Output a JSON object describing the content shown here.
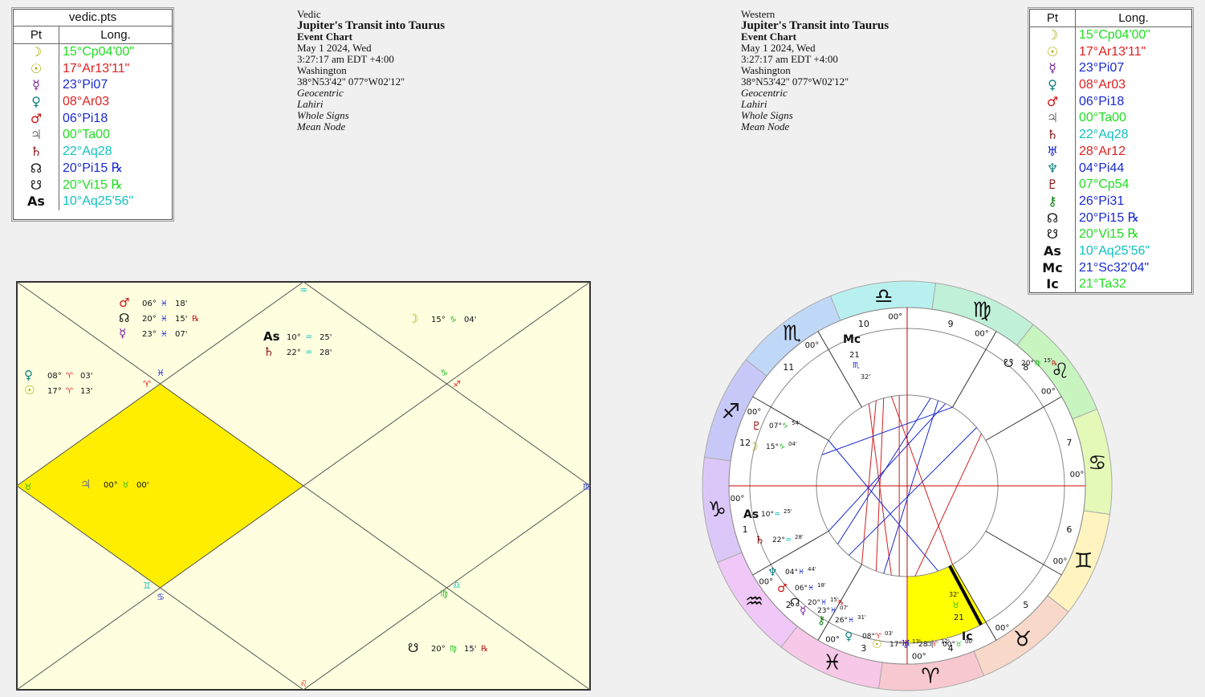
{
  "vedic_table": {
    "caption": "vedic.pts",
    "col_pt": "Pt",
    "col_long": "Long.",
    "rows": [
      {
        "glyph": "☽",
        "value": "15°Cp04'00\"",
        "color": "#22dd22",
        "glyph_color": "#a8a800",
        "icon": "moon-icon"
      },
      {
        "glyph": "☉",
        "value": "17°Ar13'11\"",
        "color": "#e02020",
        "glyph_color": "#a8a800",
        "icon": "sun-icon"
      },
      {
        "glyph": "☿",
        "value": "23°Pi07",
        "color": "#1a2ad0",
        "glyph_color": "#7a1a9a",
        "icon": "mercury-icon"
      },
      {
        "glyph": "♀",
        "value": "08°Ar03",
        "color": "#e02020",
        "glyph_color": "#108080",
        "icon": "venus-icon"
      },
      {
        "glyph": "♂",
        "value": "06°Pi18",
        "color": "#1a2ad0",
        "glyph_color": "#d01010",
        "icon": "mars-icon"
      },
      {
        "glyph": "♃",
        "value": "00°Ta00",
        "color": "#22dd22",
        "glyph_color": "#7a7a7a",
        "icon": "jupiter-icon"
      },
      {
        "glyph": "♄",
        "value": "22°Aq28",
        "color": "#10c0c0",
        "glyph_color": "#8a1010",
        "icon": "saturn-icon"
      },
      {
        "glyph": "☊",
        "value": "20°Pi15 ℞",
        "color": "#1a2ad0",
        "glyph_color": "#111111",
        "icon": "north-node-icon"
      },
      {
        "glyph": "☋",
        "value": "20°Vi15 ℞",
        "color": "#22dd22",
        "glyph_color": "#111111",
        "icon": "south-node-icon"
      },
      {
        "glyph": "As",
        "value": "10°Aq25'56\"",
        "color": "#10c0c0",
        "glyph_color": "#111111",
        "icon": "ascendant-icon"
      }
    ]
  },
  "western_table": {
    "col_pt": "Pt",
    "col_long": "Long.",
    "rows": [
      {
        "glyph": "☽",
        "value": "15°Cp04'00\"",
        "color": "#22dd22",
        "glyph_color": "#a8a800",
        "icon": "moon-icon"
      },
      {
        "glyph": "☉",
        "value": "17°Ar13'11\"",
        "color": "#e02020",
        "glyph_color": "#a8a800",
        "icon": "sun-icon"
      },
      {
        "glyph": "☿",
        "value": "23°Pi07",
        "color": "#1a2ad0",
        "glyph_color": "#7a1a9a",
        "icon": "mercury-icon"
      },
      {
        "glyph": "♀",
        "value": "08°Ar03",
        "color": "#e02020",
        "glyph_color": "#108080",
        "icon": "venus-icon"
      },
      {
        "glyph": "♂",
        "value": "06°Pi18",
        "color": "#1a2ad0",
        "glyph_color": "#d01010",
        "icon": "mars-icon"
      },
      {
        "glyph": "♃",
        "value": "00°Ta00",
        "color": "#22dd22",
        "glyph_color": "#7a7a7a",
        "icon": "jupiter-icon"
      },
      {
        "glyph": "♄",
        "value": "22°Aq28",
        "color": "#10c0c0",
        "glyph_color": "#8a1010",
        "icon": "saturn-icon"
      },
      {
        "glyph": "♅",
        "value": "28°Ar12",
        "color": "#e02020",
        "glyph_color": "#1a2ad0",
        "icon": "uranus-icon"
      },
      {
        "glyph": "♆",
        "value": "04°Pi44",
        "color": "#1a2ad0",
        "glyph_color": "#108080",
        "icon": "neptune-icon"
      },
      {
        "glyph": "♇",
        "value": "07°Cp54",
        "color": "#22dd22",
        "glyph_color": "#8a1010",
        "icon": "pluto-icon"
      },
      {
        "glyph": "⚷",
        "value": "26°Pi31",
        "color": "#1a2ad0",
        "glyph_color": "#108010",
        "icon": "chiron-icon"
      },
      {
        "glyph": "☊",
        "value": "20°Pi15 ℞",
        "color": "#1a2ad0",
        "glyph_color": "#111111",
        "icon": "north-node-icon"
      },
      {
        "glyph": "☋",
        "value": "20°Vi15 ℞",
        "color": "#22dd22",
        "glyph_color": "#111111",
        "icon": "south-node-icon"
      },
      {
        "glyph": "As",
        "value": "10°Aq25'56\"",
        "color": "#10c0c0",
        "glyph_color": "#111111",
        "icon": "ascendant-icon"
      },
      {
        "glyph": "Mc",
        "value": "21°Sc32'04\"",
        "color": "#1a2ad0",
        "glyph_color": "#111111",
        "icon": "midheaven-icon"
      },
      {
        "glyph": "Ic",
        "value": "21°Ta32",
        "color": "#22dd22",
        "glyph_color": "#111111",
        "icon": "imum-coeli-icon"
      }
    ]
  },
  "vedic_header": {
    "system": "Vedic",
    "title": "Jupiter's Transit into Taurus",
    "chart_type": "Event Chart",
    "date": "May 1 2024, Wed",
    "time": "3:27:17 am  EDT +4:00",
    "place": "Washington",
    "coords": "38°N53'42'' 077°W02'12''",
    "opt1": "Geocentric",
    "opt2": "Lahiri",
    "opt3": "Whole Signs",
    "opt4": "Mean Node"
  },
  "western_header": {
    "system": "Western",
    "title": "Jupiter's Transit into Taurus",
    "chart_type": "Event Chart",
    "date": "May 1 2024, Wed",
    "time": "3:27:17 am  EDT +4:00",
    "place": "Washington",
    "coords": "38°N53'42'' 077°W02'12''",
    "opt1": "Geocentric",
    "opt2": "Lahiri",
    "opt3": "Whole Signs",
    "opt4": "Mean Node"
  },
  "north_chart": {
    "highlight_color": "#ffee00",
    "sign_labels": [
      {
        "t": "♒",
        "c": "#10c0c0"
      },
      {
        "t": "♓",
        "c": "#1a2ad0"
      },
      {
        "t": "♈",
        "c": "#e02020"
      },
      {
        "t": "♑",
        "c": "#22bb22"
      },
      {
        "t": "♐",
        "c": "#e02020"
      },
      {
        "t": "♉",
        "c": "#22bb22"
      },
      {
        "t": "♏",
        "c": "#1a2ad0"
      },
      {
        "t": "♊",
        "c": "#10c0c0"
      },
      {
        "t": "♋",
        "c": "#1a2ad0"
      },
      {
        "t": "♍",
        "c": "#22bb22"
      },
      {
        "t": "♎",
        "c": "#10c0c0"
      },
      {
        "t": "♌",
        "c": "#e02020"
      }
    ],
    "groups": [
      {
        "name": "house-12-planets",
        "items": [
          {
            "g": "♂",
            "gc": "#d01010",
            "deg": "06°",
            "sign": "♓",
            "sc": "#1a2ad0",
            "min": "18'",
            "r": ""
          },
          {
            "g": "☊",
            "gc": "#111111",
            "deg": "20°",
            "sign": "♓",
            "sc": "#1a2ad0",
            "min": "15'",
            "r": "℞"
          },
          {
            "g": "☿",
            "gc": "#7a1a9a",
            "deg": "23°",
            "sign": "♓",
            "sc": "#1a2ad0",
            "min": "07'",
            "r": ""
          }
        ]
      },
      {
        "name": "house-1-planets",
        "items": [
          {
            "g": "As",
            "gc": "#111111",
            "deg": "10°",
            "sign": "♒",
            "sc": "#10c0c0",
            "min": "25'",
            "r": ""
          },
          {
            "g": "♄",
            "gc": "#8a1010",
            "deg": "22°",
            "sign": "♒",
            "sc": "#10c0c0",
            "min": "28'",
            "r": ""
          }
        ]
      },
      {
        "name": "house-11-planets",
        "items": [
          {
            "g": "☽",
            "gc": "#a8a800",
            "deg": "15°",
            "sign": "♑",
            "sc": "#22bb22",
            "min": "04'",
            "r": ""
          }
        ]
      },
      {
        "name": "house-2-planets",
        "items": [
          {
            "g": "♀",
            "gc": "#108080",
            "deg": "08°",
            "sign": "♈",
            "sc": "#e02020",
            "min": "03'",
            "r": ""
          },
          {
            "g": "☉",
            "gc": "#a8a800",
            "deg": "17°",
            "sign": "♈",
            "sc": "#e02020",
            "min": "13'",
            "r": ""
          }
        ]
      },
      {
        "name": "house-4-planets",
        "items": [
          {
            "g": "♃",
            "gc": "#7a7a7a",
            "deg": "00°",
            "sign": "♉",
            "sc": "#22bb22",
            "min": "00'",
            "r": ""
          }
        ]
      },
      {
        "name": "house-7-planets",
        "items": [
          {
            "g": "☋",
            "gc": "#111111",
            "deg": "20°",
            "sign": "♍",
            "sc": "#22bb22",
            "min": "15'",
            "r": "℞"
          }
        ]
      }
    ]
  },
  "wheel": {
    "house_numbers": [
      "1",
      "2",
      "3",
      "4",
      "5",
      "6",
      "7",
      "8",
      "9",
      "10",
      "11",
      "12"
    ],
    "cusp_label": "00°",
    "signs": [
      {
        "g": "♈",
        "fill": "#f8c8d0",
        "c": "#cc0000"
      },
      {
        "g": "♉",
        "fill": "#f8d8c8",
        "c": "#cc0000"
      },
      {
        "g": "♊",
        "fill": "#fff4c0",
        "c": "#cc0000"
      },
      {
        "g": "♋",
        "fill": "#e4f8b8",
        "c": "#cc0000"
      },
      {
        "g": "♌",
        "fill": "#c8f4c0",
        "c": "#cc0000"
      },
      {
        "g": "♍",
        "fill": "#c0f0d8",
        "c": "#cc0000"
      },
      {
        "g": "♎",
        "fill": "#b8f0f0",
        "c": "#cc0000"
      },
      {
        "g": "♏",
        "fill": "#c0d8f8",
        "c": "#cc0000"
      },
      {
        "g": "♐",
        "fill": "#c8c8f8",
        "c": "#cc0000"
      },
      {
        "g": "♑",
        "fill": "#dcc8f8",
        "c": "#cc0000"
      },
      {
        "g": "♒",
        "fill": "#f0c8f8",
        "c": "#cc0000"
      },
      {
        "g": "♓",
        "fill": "#f8c8e8",
        "c": "#cc0000"
      }
    ],
    "mc_label": {
      "g": "Mc",
      "deg": "21",
      "sign": "♏",
      "min": "32'"
    },
    "ic_label": {
      "g": "Ic",
      "deg": "21",
      "sign": "♉",
      "min": "32'"
    },
    "planets": [
      {
        "g": "☋",
        "gc": "#111111",
        "deg": "20°",
        "sign": "♍",
        "sc": "#22bb22",
        "min": "15'",
        "r": "℞"
      },
      {
        "g": "♇",
        "gc": "#8a1010",
        "deg": "07°",
        "sign": "♑",
        "sc": "#22bb22",
        "min": "54'",
        "r": ""
      },
      {
        "g": "☽",
        "gc": "#a8a800",
        "deg": "15°",
        "sign": "♑",
        "sc": "#22bb22",
        "min": "04'",
        "r": ""
      },
      {
        "g": "As",
        "gc": "#111111",
        "deg": "10°",
        "sign": "♒",
        "sc": "#10c0c0",
        "min": "25'",
        "r": ""
      },
      {
        "g": "♄",
        "gc": "#8a1010",
        "deg": "22°",
        "sign": "♒",
        "sc": "#10c0c0",
        "min": "28'",
        "r": ""
      },
      {
        "g": "♆",
        "gc": "#108080",
        "deg": "04°",
        "sign": "♓",
        "sc": "#1a2ad0",
        "min": "44'",
        "r": ""
      },
      {
        "g": "♂",
        "gc": "#d01010",
        "deg": "06°",
        "sign": "♓",
        "sc": "#1a2ad0",
        "min": "18'",
        "r": ""
      },
      {
        "g": "☊",
        "gc": "#111111",
        "deg": "20°",
        "sign": "♓",
        "sc": "#1a2ad0",
        "min": "15'",
        "r": "℞"
      },
      {
        "g": "☿",
        "gc": "#7a1a9a",
        "deg": "23°",
        "sign": "♓",
        "sc": "#1a2ad0",
        "min": "07'",
        "r": ""
      },
      {
        "g": "⚷",
        "gc": "#108010",
        "deg": "26°",
        "sign": "♓",
        "sc": "#1a2ad0",
        "min": "31'",
        "r": ""
      },
      {
        "g": "♀",
        "gc": "#108080",
        "deg": "08°",
        "sign": "♈",
        "sc": "#e02020",
        "min": "03'",
        "r": ""
      },
      {
        "g": "☉",
        "gc": "#a8a800",
        "deg": "17°",
        "sign": "♈",
        "sc": "#e02020",
        "min": "13'",
        "r": ""
      },
      {
        "g": "♅",
        "gc": "#1a2ad0",
        "deg": "28°",
        "sign": "♈",
        "sc": "#e02020",
        "min": "12'",
        "r": ""
      },
      {
        "g": "♃",
        "gc": "#7a7a7a",
        "deg": "00°",
        "sign": "♉",
        "sc": "#22bb22",
        "min": "00'",
        "r": ""
      }
    ]
  }
}
